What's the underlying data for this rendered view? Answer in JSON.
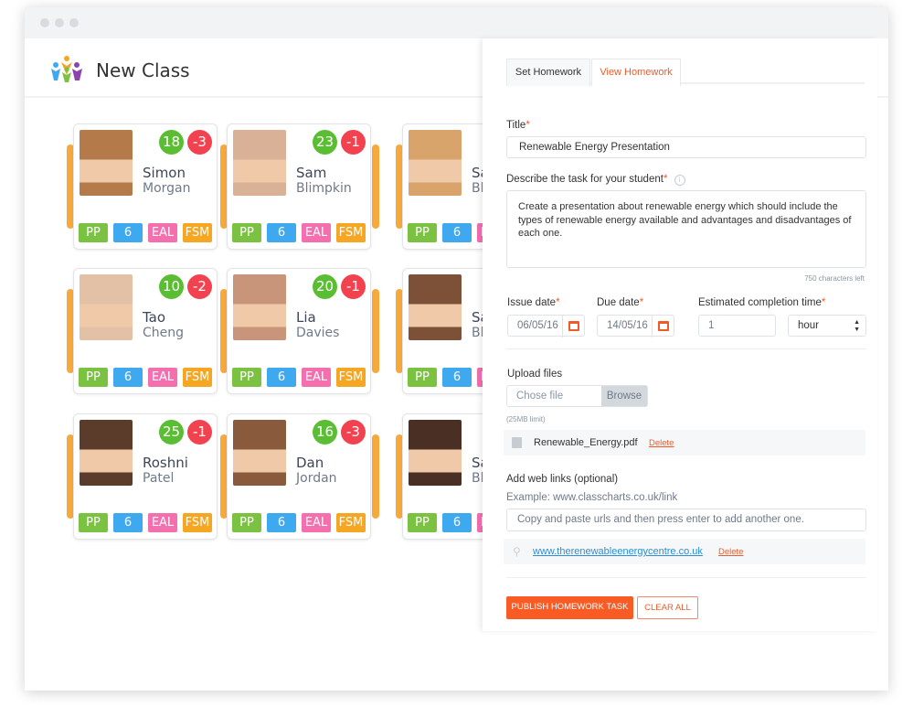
{
  "header": {
    "title": "New Class"
  },
  "students": [
    {
      "first": "Simon",
      "last": "Morgan",
      "positive": "18",
      "negative": "-3",
      "photo": "#b47a4a"
    },
    {
      "first": "Sam",
      "last": "Blimpkin",
      "positive": "23",
      "negative": "-1",
      "photo": "#d8b196"
    },
    {
      "first": "Sam",
      "last": "Blimpkin",
      "positive": "",
      "negative": "",
      "photo": "#d9a36c"
    },
    {
      "first": "Tao",
      "last": "Cheng",
      "positive": "10",
      "negative": "-2",
      "photo": "#e3c1a6"
    },
    {
      "first": "Lia",
      "last": "Davies",
      "positive": "20",
      "negative": "-1",
      "photo": "#c9957a"
    },
    {
      "first": "Sam",
      "last": "Blimpkin",
      "positive": "",
      "negative": "",
      "photo": "#7d5138"
    },
    {
      "first": "Roshni",
      "last": "Patel",
      "positive": "25",
      "negative": "-1",
      "photo": "#5b3b2a"
    },
    {
      "first": "Dan",
      "last": "Jordan",
      "positive": "16",
      "negative": "-3",
      "photo": "#8a5a3c"
    },
    {
      "first": "Sam",
      "last": "Blimpkin",
      "positive": "",
      "negative": "",
      "photo": "#4a3024"
    }
  ],
  "tags": [
    {
      "label": "PP",
      "color": "#7cc242"
    },
    {
      "label": "6",
      "color": "#3fa9f0"
    },
    {
      "label": "EAL",
      "color": "#f46fae"
    },
    {
      "label": "FSM",
      "color": "#f5a623"
    }
  ],
  "panel": {
    "tabs": [
      "Set Homework",
      "View Homework"
    ],
    "title_label": "Title",
    "required": "*",
    "title_value": "Renewable Energy Presentation",
    "desc_label": "Describe the task for your student",
    "desc_value": "Create a presentation about renewable energy which should include the types of renewable energy available and advantages and disadvantages of each one.",
    "chars_left": "750 characters left",
    "issue_label": "Issue date",
    "issue_value": "06/05/16",
    "due_label": "Due date",
    "due_value": "14/05/16",
    "est_label": "Estimated completion time",
    "est_value": "1",
    "est_unit": "hour",
    "upload_label": "Upload files",
    "file_placeholder": "Chose file",
    "browse": "Browse",
    "limit": "(25MB limit)",
    "file_name": "Renewable_Energy.pdf",
    "delete": "Delete",
    "links_label": "Add web links (optional)",
    "links_example": "Example: www.classcharts.co.uk/link",
    "links_placeholder": "Copy and paste urls and then press enter to add another one.",
    "link": "www.therenewableenergycentre.co.uk",
    "publish": "PUBLISH HOMEWORK TASK",
    "clear": "CLEAR ALL"
  },
  "colors": {
    "accent": "#f05a28",
    "link": "#2a8fd6"
  }
}
